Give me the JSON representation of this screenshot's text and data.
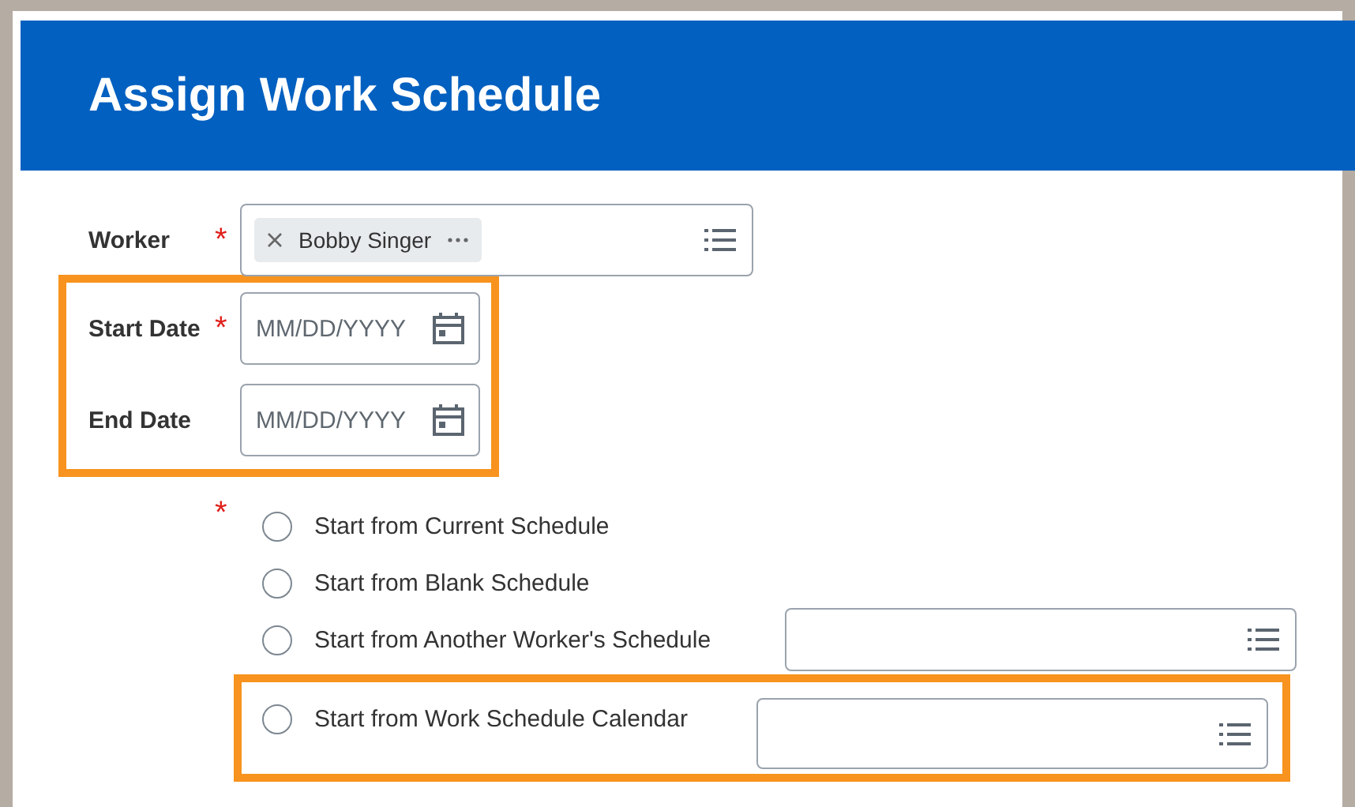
{
  "header": {
    "title": "Assign Work Schedule"
  },
  "worker": {
    "label": "Worker",
    "required_mark": "*",
    "chips": [
      "Bobby Singer"
    ]
  },
  "date_group": {
    "highlighted": true,
    "fields": [
      {
        "label": "Start Date",
        "required_mark": "*",
        "placeholder": "MM/DD/YYYY"
      },
      {
        "label": "End Date",
        "placeholder": "MM/DD/YYYY"
      }
    ]
  },
  "schedule_source": {
    "required_mark": "*",
    "options": [
      {
        "label": "Start from Current Schedule",
        "selected": false,
        "has_prompt": false,
        "highlighted": false
      },
      {
        "label": "Start from Blank Schedule",
        "selected": false,
        "has_prompt": false,
        "highlighted": false
      },
      {
        "label": "Start from Another Worker's Schedule",
        "selected": false,
        "has_prompt": true,
        "highlighted": false
      },
      {
        "label": "Start from Work Schedule Calendar",
        "selected": false,
        "has_prompt": true,
        "highlighted": true
      }
    ]
  }
}
